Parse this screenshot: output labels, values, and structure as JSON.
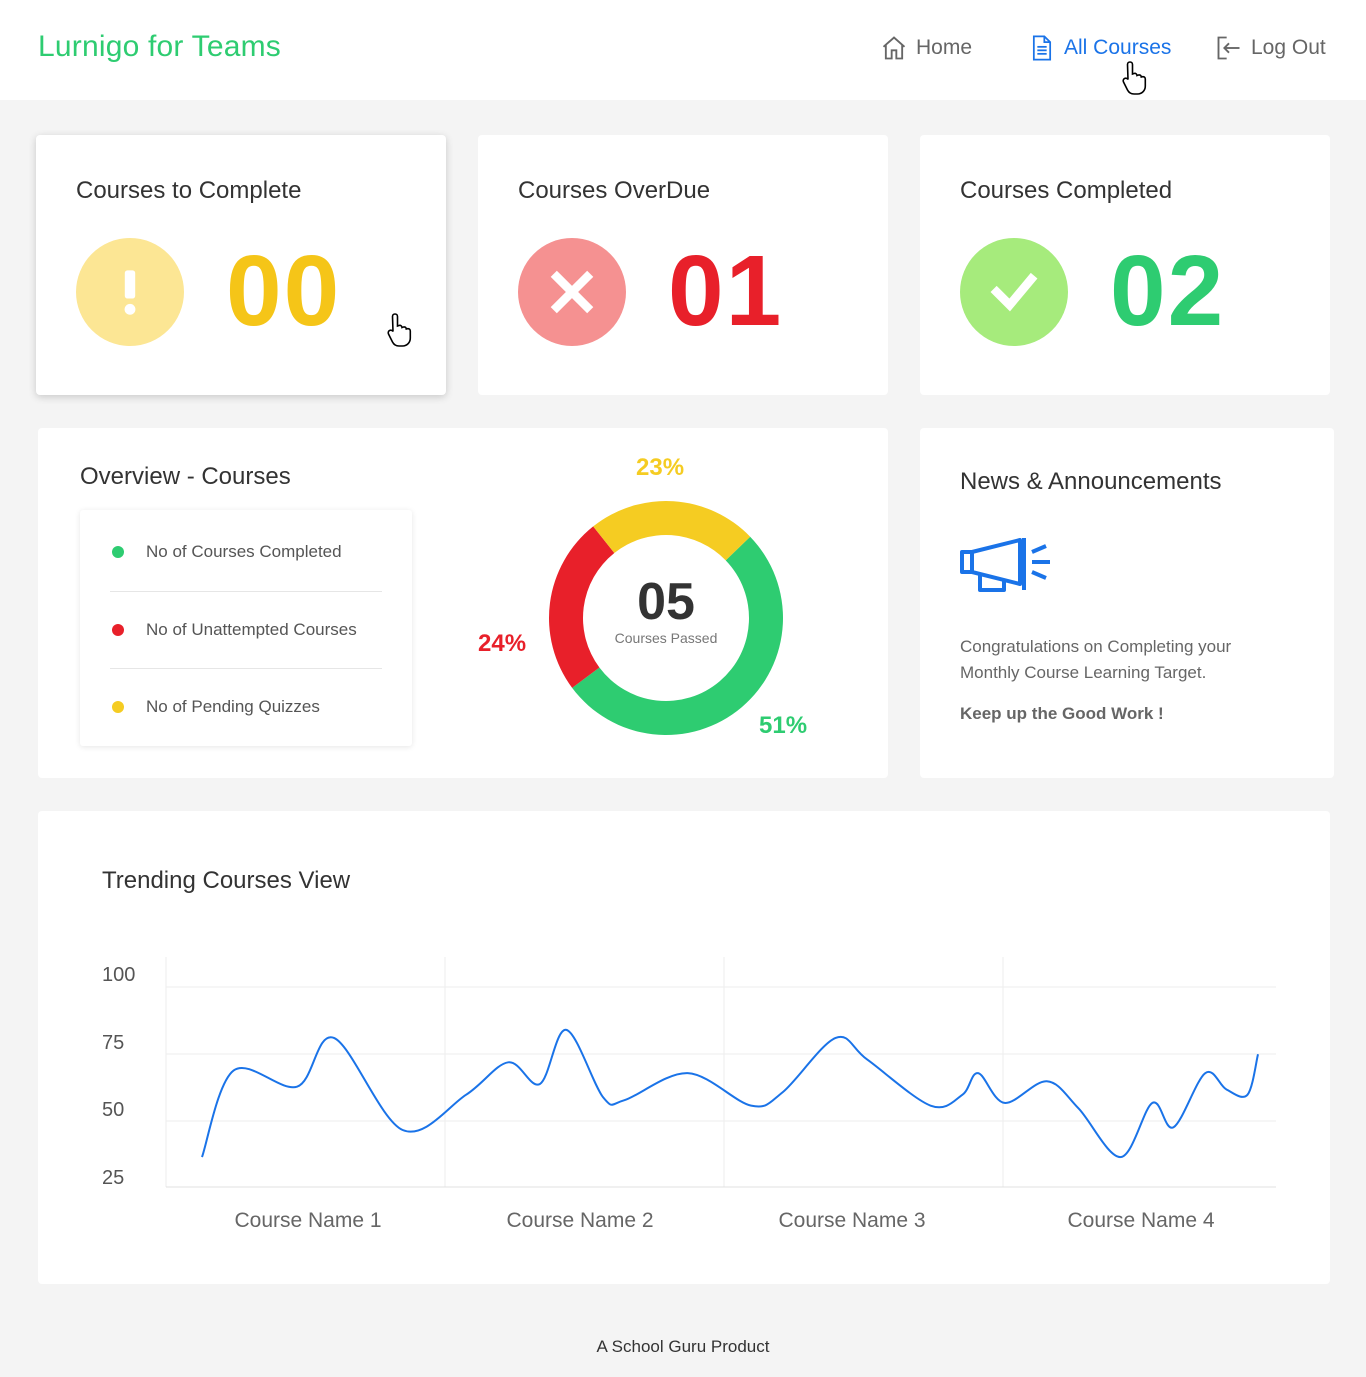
{
  "header": {
    "brand": "Lurnigo for Teams",
    "nav": {
      "home": "Home",
      "all_courses": "All Courses",
      "log_out": "Log Out"
    }
  },
  "stats": {
    "to_complete": {
      "title": "Courses to Complete",
      "value": "00",
      "color": "#f5c518",
      "circle_color": "#fce694",
      "icon": "exclamation-icon"
    },
    "overdue": {
      "title": "Courses OverDue",
      "value": "01",
      "color": "#e8202a",
      "circle_color": "#f59191",
      "icon": "close-icon"
    },
    "completed": {
      "title": "Courses Completed",
      "value": "02",
      "color": "#2ecc71",
      "circle_color": "#a6eb7c",
      "icon": "check-icon"
    }
  },
  "overview": {
    "title": "Overview - Courses",
    "legend": [
      {
        "label": "No of Courses Completed",
        "color": "#2ecc71"
      },
      {
        "label": "No of Unattempted Courses",
        "color": "#e8202a"
      },
      {
        "label": "No of Pending Quizzes",
        "color": "#f5cc22"
      }
    ],
    "center_value": "05",
    "center_label": "Courses Passed",
    "slices": [
      {
        "label": "51%",
        "value": 51,
        "color": "#2ecc71"
      },
      {
        "label": "24%",
        "value": 24,
        "color": "#e8202a"
      },
      {
        "label": "23%",
        "value": 23,
        "color": "#f5cc22"
      }
    ]
  },
  "news": {
    "title": "News & Announcements",
    "icon": "megaphone-icon",
    "message": "Congratulations on Completing  your Monthly Course Learning Target.",
    "highlight": "Keep up the Good Work !"
  },
  "chart_data": {
    "type": "line",
    "title": "Trending Courses View",
    "xlabel": "",
    "ylabel": "",
    "categories": [
      "Course Name 1",
      "Course Name 2",
      "Course Name 3",
      "Course Name 4"
    ],
    "yticks": [
      100,
      75,
      50,
      25
    ],
    "ylim": [
      25,
      100
    ],
    "grid": true,
    "color": "#1a73e8",
    "series": [
      {
        "points": [
          [
            0.0,
            32
          ],
          [
            0.03,
            64
          ],
          [
            0.09,
            58
          ],
          [
            0.125,
            76
          ],
          [
            0.19,
            42
          ],
          [
            0.25,
            55
          ],
          [
            0.29,
            67
          ],
          [
            0.32,
            59
          ],
          [
            0.345,
            79
          ],
          [
            0.38,
            54
          ],
          [
            0.4,
            53
          ],
          [
            0.46,
            63
          ],
          [
            0.52,
            51
          ],
          [
            0.55,
            56
          ],
          [
            0.6,
            76
          ],
          [
            0.63,
            68
          ],
          [
            0.69,
            51
          ],
          [
            0.72,
            55
          ],
          [
            0.735,
            63
          ],
          [
            0.76,
            52
          ],
          [
            0.8,
            60
          ],
          [
            0.83,
            50
          ],
          [
            0.87,
            32
          ],
          [
            0.9,
            52
          ],
          [
            0.92,
            43
          ],
          [
            0.95,
            63
          ],
          [
            0.97,
            57
          ],
          [
            0.99,
            55
          ],
          [
            1.0,
            70
          ]
        ]
      }
    ]
  }
}
